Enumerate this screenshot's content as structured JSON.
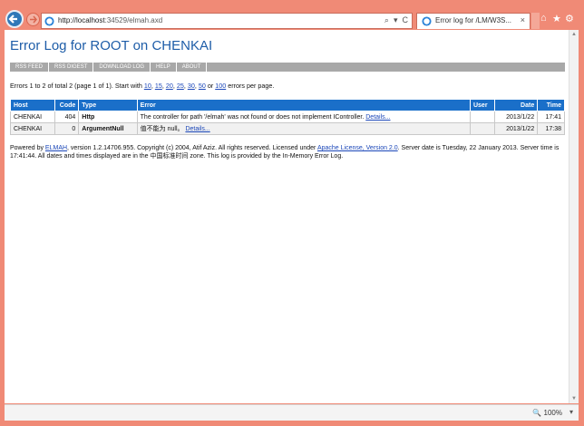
{
  "browser": {
    "url_host": "http://localhost",
    "url_rest": ":34529/elmah.axd",
    "tab_title": "Error log for /LM/W3S...",
    "zoom": "100%",
    "address_tools": [
      "⌕",
      "▾",
      "C"
    ],
    "window_controls": [
      "⌂",
      "★",
      "⚙"
    ]
  },
  "page": {
    "title": "Error Log for ROOT on CHENKAI",
    "menu": [
      "RSS FEED",
      "RSS DIGEST",
      "DOWNLOAD LOG",
      "HELP",
      "ABOUT"
    ],
    "summary": {
      "prefix": "Errors 1 to 2 of total 2 (page 1 of 1). Start with",
      "counts": [
        "10",
        "15",
        "20",
        "25",
        "30",
        "50",
        "100"
      ],
      "suffix": "errors per page."
    },
    "table": {
      "headers": [
        "Host",
        "Code",
        "Type",
        "Error",
        "User",
        "Date",
        "Time"
      ],
      "rows": [
        {
          "host": "CHENKAI",
          "code": "404",
          "type": "Http",
          "error": "The controller for path '/elmah' was not found or does not implement IController.",
          "user": "",
          "date": "2013/1/22",
          "time": "17:41",
          "details": "Details..."
        },
        {
          "host": "CHENKAI",
          "code": "0",
          "type": "ArgumentNull",
          "error": "值不能为 null。",
          "user": "",
          "date": "2013/1/22",
          "time": "17:38",
          "details": "Details..."
        }
      ]
    },
    "footer": {
      "powered": "Powered by",
      "elmah": "ELMAH",
      "middle": ", version 1.2.14706.955. Copyright (c) 2004, Atif Aziz. All rights reserved. Licensed under",
      "license": "Apache License, Version 2.0",
      "end": ". Server date is Tuesday, 22 January 2013. Server time is 17:41:44. All dates and times displayed are in the 中国标准时间 zone. This log is provided by the In-Memory Error Log."
    }
  }
}
